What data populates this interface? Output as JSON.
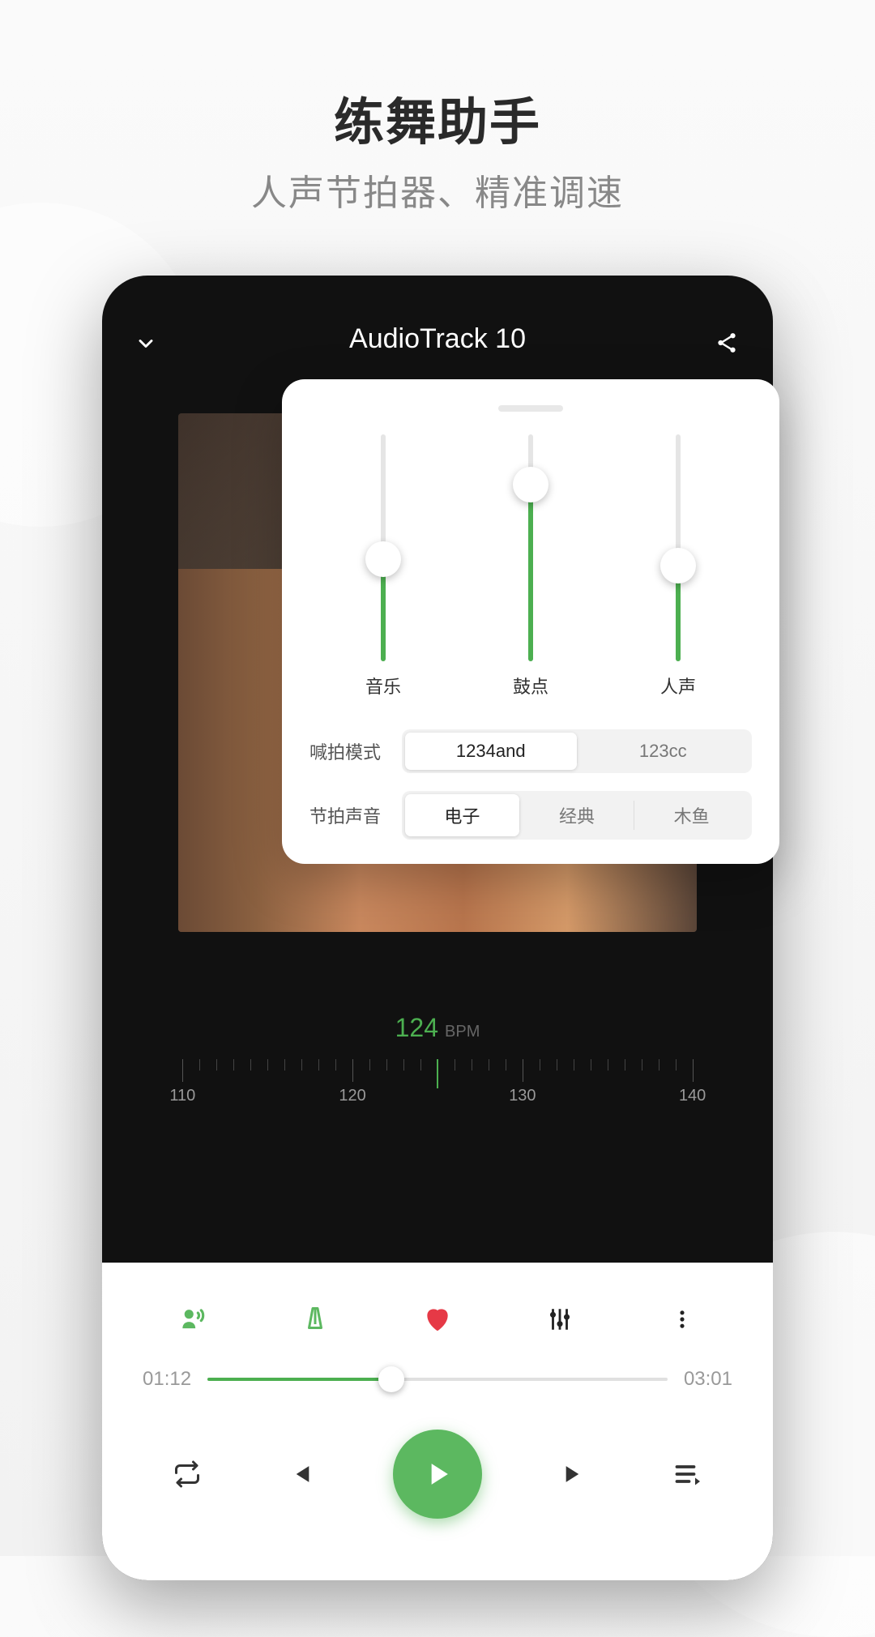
{
  "headline": {
    "title": "练舞助手",
    "subtitle": "人声节拍器、精准调速"
  },
  "player": {
    "title": "AudioTrack 10",
    "bpm_value": "124",
    "bpm_unit": "BPM",
    "ruler_labels": [
      "110",
      "120",
      "130",
      "140"
    ],
    "progress": {
      "current": "01:12",
      "total": "03:01",
      "percent": 40
    }
  },
  "panel": {
    "sliders": [
      {
        "label": "音乐",
        "percent": 45
      },
      {
        "label": "鼓点",
        "percent": 78
      },
      {
        "label": "人声",
        "percent": 42
      }
    ],
    "mode": {
      "label": "喊拍模式",
      "options": [
        "1234and",
        "123cc"
      ],
      "active": 0
    },
    "sound": {
      "label": "节拍声音",
      "options": [
        "电子",
        "经典",
        "木鱼"
      ],
      "active": 0
    }
  },
  "colors": {
    "accent": "#4caf50"
  }
}
